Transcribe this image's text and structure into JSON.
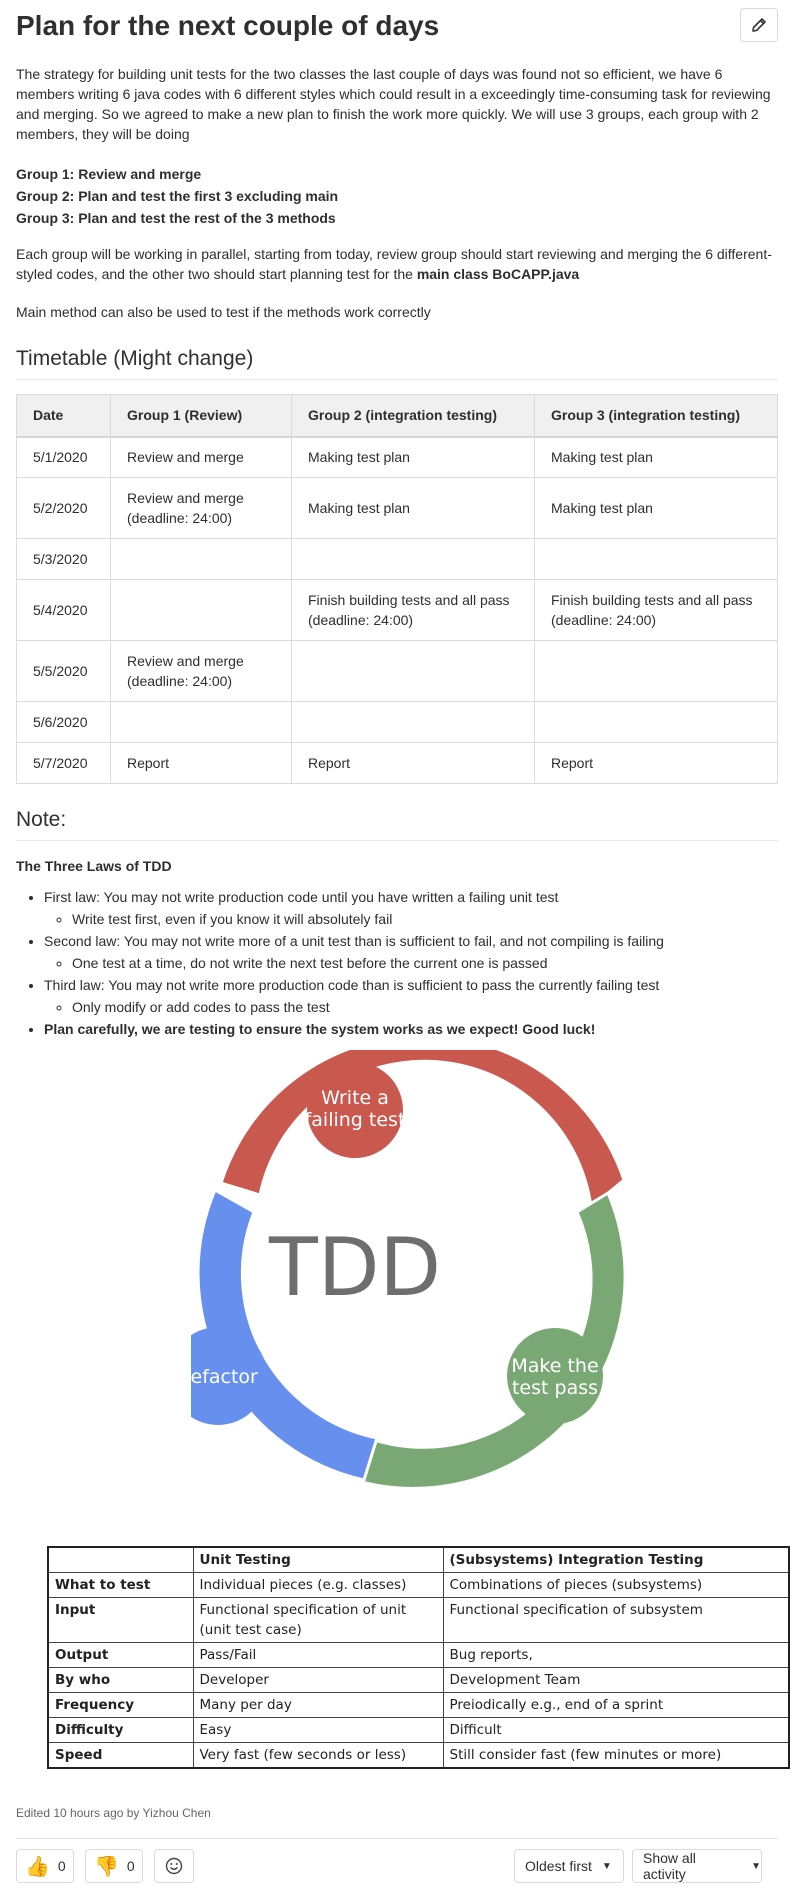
{
  "page": {
    "title": "Plan for the next couple of days",
    "edit_icon": "pencil-icon"
  },
  "intro": {
    "text": "The strategy for building unit tests for the two classes the last couple of days was found not so efficient, we have 6 members writing 6 java codes with 6 different styles which could result in a exceedingly time-consuming task for reviewing and merging. So we agreed to make a new plan to finish the work more quickly. We will use 3 groups, each group with 2 members, they will be doing"
  },
  "groups": [
    "Group 1: Review and merge",
    "Group 2: Plan and test the first 3 excluding main",
    "Group 3: Plan and test the rest of the 3 methods"
  ],
  "parallel": {
    "text": "Each group will be working in parallel, starting from today, review group should start reviewing and merging the 6 different-styled codes, and the other two should start planning test for the ",
    "bold": "main class BoCAPP.java"
  },
  "main_method_note": "Main method can also be used to test if the methods work correctly",
  "timetable": {
    "heading": "Timetable (Might change)",
    "columns": [
      "Date",
      "Group 1 (Review)",
      "Group 2 (integration testing)",
      "Group 3 (integration testing)"
    ],
    "rows": [
      [
        "5/1/2020",
        "Review and merge",
        "Making test plan",
        "Making test plan"
      ],
      [
        "5/2/2020",
        "Review and merge (deadline: 24:00)",
        "Making test plan",
        "Making test plan"
      ],
      [
        "5/3/2020",
        "",
        "",
        ""
      ],
      [
        "5/4/2020",
        "",
        "Finish building tests and all pass (deadline: 24:00)",
        "Finish building tests and all pass (deadline: 24:00)"
      ],
      [
        "5/5/2020",
        "Review and merge (deadline: 24:00)",
        "",
        ""
      ],
      [
        "5/6/2020",
        "",
        "",
        ""
      ],
      [
        "5/7/2020",
        "Report",
        "Report",
        "Report"
      ]
    ]
  },
  "note": {
    "heading": "Note:",
    "laws_title": "The Three Laws of TDD",
    "laws": [
      {
        "text": "First law: You may not write production code until you have written a failing unit test",
        "sub": "Write test first, even if you know it will absolutely fail"
      },
      {
        "text": "Second law: You may not write more of a unit test than is sufficient to fail, and not compiling is failing",
        "sub": "One test at a time, do not write the next test before the current one is passed"
      },
      {
        "text": "Third law: You may not write more production code than is sufficient to pass the currently failing test",
        "sub": "Only modify or add codes to pass the test"
      }
    ],
    "closing": "Plan carefully, we are testing to ensure the system works as we expect! Good luck!"
  },
  "tdd_diagram": {
    "center": "TDD",
    "write_line1": "Write a",
    "write_line2": "failing test",
    "pass_line1": "Make the",
    "pass_line2": "test pass",
    "refactor": "Refactor",
    "colors": {
      "red": "#c9584f",
      "green": "#79a874",
      "blue": "#6790ee",
      "text": "#6e6e6e"
    }
  },
  "comparison": {
    "headers": [
      "",
      "Unit Testing",
      "(Subsystems) Integration Testing"
    ],
    "rows": [
      [
        "What to test",
        "Individual pieces (e.g. classes)",
        "Combinations of pieces (subsystems)"
      ],
      [
        "Input",
        "Functional specification of unit (unit test case)",
        "Functional specification of subsystem"
      ],
      [
        "Output",
        "Pass/Fail",
        "Bug reports,"
      ],
      [
        "By who",
        "Developer",
        "Development Team"
      ],
      [
        "Frequency",
        "Many per day",
        "Preiodically e.g., end of a sprint"
      ],
      [
        "Difficulty",
        "Easy",
        "Difficult"
      ],
      [
        "Speed",
        "Very fast (few seconds or less)",
        "Still consider fast (few minutes or more)"
      ]
    ]
  },
  "footer": {
    "edited_prefix": "Edited 10 hours ago by ",
    "edited_user": "Yizhou Chen",
    "thumbs_up_count": "0",
    "thumbs_down_count": "0",
    "sort_label": "Oldest first",
    "activity_label": "Show all activity"
  }
}
